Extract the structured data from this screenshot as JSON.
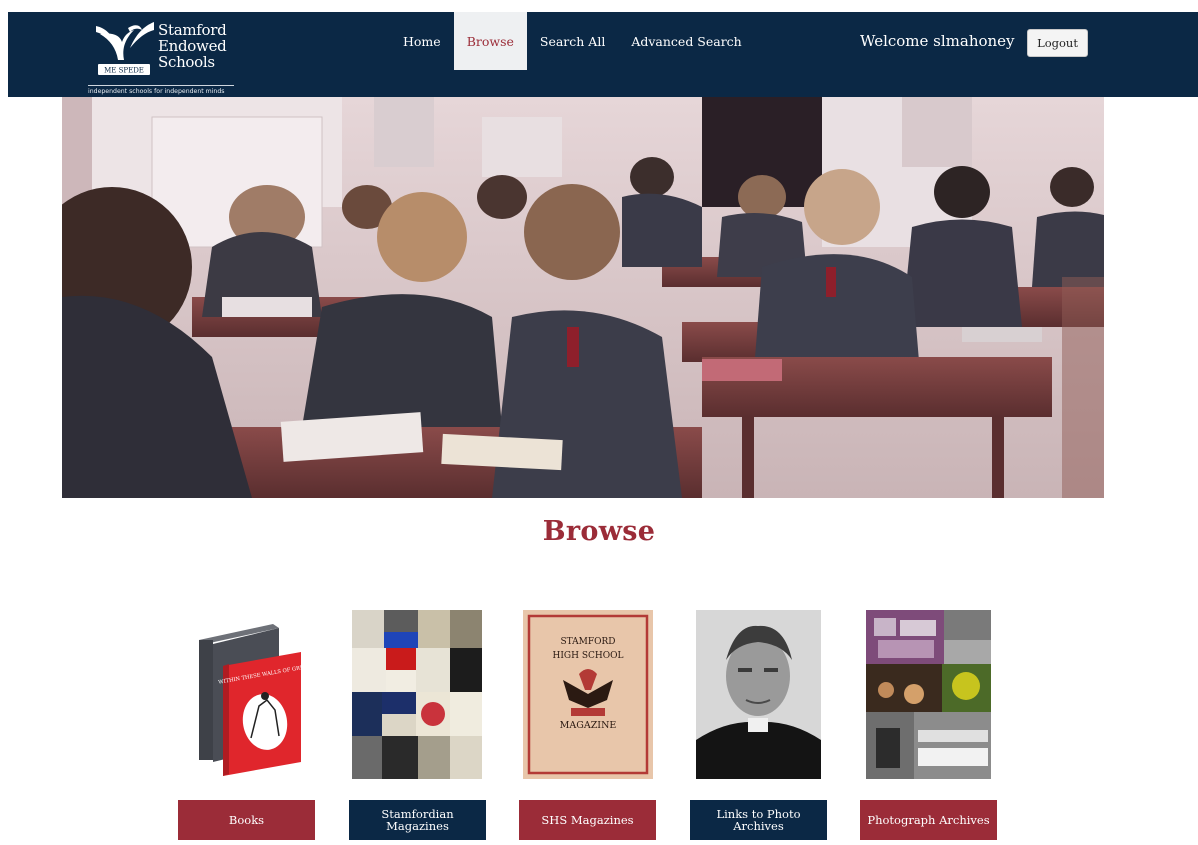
{
  "header": {
    "logo_line1": "Stamford",
    "logo_line2": "Endowed",
    "logo_line3": "Schools",
    "logo_motto": "ME SPEDE",
    "tagline": "independent schools for independent minds",
    "welcome": "Welcome slmahoney",
    "logout_label": "Logout"
  },
  "nav": {
    "items": [
      {
        "label": "Home"
      },
      {
        "label": "Browse"
      },
      {
        "label": "Search All"
      },
      {
        "label": "Advanced Search"
      }
    ],
    "active": "Browse"
  },
  "main": {
    "heading": "Browse",
    "cards": [
      {
        "label": "Books",
        "cover_title": "WITHIN THESE WALLS OF GREY"
      },
      {
        "label": "Stamfordian Magazines"
      },
      {
        "label": "SHS Magazines",
        "cover_line1": "STAMFORD",
        "cover_line2": "HIGH SCHOOL",
        "cover_line3": "MAGAZINE"
      },
      {
        "label": "Links to Photo Archives"
      },
      {
        "label": "Photograph Archives"
      }
    ]
  },
  "colors": {
    "navy": "#0b2845",
    "accent": "#9b2c38",
    "nav_active_bg": "#eef0f2"
  }
}
